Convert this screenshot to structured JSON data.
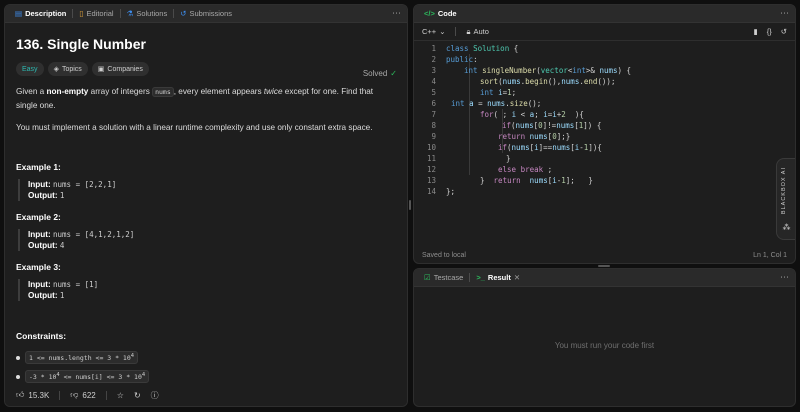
{
  "left_tabs": {
    "description": "Description",
    "editorial": "Editorial",
    "solutions": "Solutions",
    "submissions": "Submissions"
  },
  "problem": {
    "title": "136. Single Number",
    "solved": "Solved",
    "badges": {
      "difficulty": "Easy",
      "topics": "Topics",
      "companies": "Companies"
    },
    "p1_a": "Given a ",
    "p1_b": "non-empty",
    "p1_c": " array of integers ",
    "p1_code": "nums",
    "p1_d": ", every element appears ",
    "p1_e": "twice",
    "p1_f": " except for one. Find that single one.",
    "p2": "You must implement a solution with a linear runtime complexity and use only constant extra space."
  },
  "examples": [
    {
      "heading": "Example 1:",
      "input_label": "Input:",
      "input": "nums = [2,2,1]",
      "output_label": "Output:",
      "output": "1"
    },
    {
      "heading": "Example 2:",
      "input_label": "Input:",
      "input": "nums = [4,1,2,1,2]",
      "output_label": "Output:",
      "output": "4"
    },
    {
      "heading": "Example 3:",
      "input_label": "Input:",
      "input": "nums = [1]",
      "output_label": "Output:",
      "output": "1"
    }
  ],
  "constraints": {
    "heading": "Constraints:",
    "c1_a": "1 <= nums.length <= 3 * 10",
    "c1_sup": "4",
    "c2_a": "-3 * 10",
    "c2_sup1": "4",
    "c2_b": " <= nums[i] <= 3 * 10",
    "c2_sup2": "4"
  },
  "footer": {
    "likes": "15.3K",
    "dislikes": "622"
  },
  "code_panel": {
    "title": "Code",
    "language": "C++",
    "mode": "Auto",
    "saved": "Saved to local",
    "position": "Ln 1, Col 1",
    "line_numbers": [
      "1",
      "2",
      "3",
      "4",
      "5",
      "6",
      "7",
      "8",
      "9",
      "10",
      "11",
      "12",
      "13",
      "14"
    ]
  },
  "result_panel": {
    "tab_testcase": "Testcase",
    "tab_result": "Result",
    "empty": "You must run your code first"
  },
  "blackbox": {
    "label": "BLACKBOX AI"
  }
}
